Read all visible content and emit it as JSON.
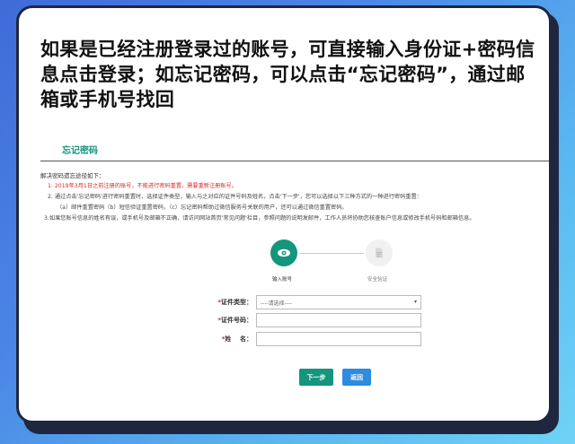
{
  "headline": "如果是已经注册登录过的账号，可直接输入身份证+密码信息点击登录；如忘记密码，可以点击“忘记密码”，通过邮箱或手机号找回",
  "section_title": "忘记密码",
  "intro": "解决密码遗忘途径如下：",
  "rules": [
    "1. 2019年3月1日之前注册的账号，不能进行密码重置，需要重新注册账号。",
    "2. 通过点击'忘记密码'进行密码重置时，选择证件类型，输入与之对应的证件号码及姓名，点击'下一步'，您可以选择以下三种方式的一种进行密码重置：",
    "（a）邮件重置密码（b）短信验证重置密码，（c）忘记密码帮助过微信服务号关联的用户，还可以通过微信重置密码。",
    "3.如果您账号信息的姓名有误，或手机号及邮箱不正确，请访问网站首页'常见问题'栏目，参照问题的说明发邮件，工作人员将协助您核查账户信息或修改手机号码和邮箱信息。"
  ],
  "steps": [
    {
      "label": "输入账号",
      "icon": "eye-icon",
      "active": true
    },
    {
      "label": "安全验证",
      "icon": "document-icon",
      "active": false
    }
  ],
  "form": {
    "id_type": {
      "label": "证件类型：",
      "value": "----请选择----"
    },
    "id_number": {
      "label": "证件号码：",
      "value": ""
    },
    "name": {
      "label": "姓    名：",
      "value": ""
    }
  },
  "buttons": {
    "next": "下一步",
    "back": "返回"
  },
  "colors": {
    "accent": "#14957d",
    "link_blue": "#2d8be0",
    "warning_red": "#d42a2a"
  }
}
